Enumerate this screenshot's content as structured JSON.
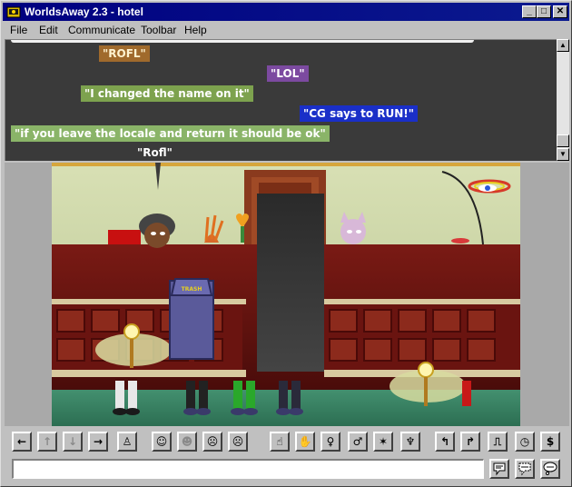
{
  "window": {
    "title": "WorldsAway 2.3 - hotel",
    "controls": {
      "minimize": "_",
      "maximize": "□",
      "close": "✕"
    }
  },
  "menu": {
    "items": [
      "File",
      "Edit",
      "Communicate",
      "Toolbar",
      "Help"
    ]
  },
  "chat": {
    "messages": [
      {
        "text": "\"ROFL\"",
        "color": "#a06a2c",
        "text_color": "#fff3d0"
      },
      {
        "text": "\"LOL\"",
        "color": "#7c4aa0",
        "text_color": "#ffffff"
      },
      {
        "text": "\"I changed the name on it\"",
        "color": "#7da24e",
        "text_color": "#ffffff"
      },
      {
        "text": "\"CG says to RUN!\"",
        "color": "#1a2fc8",
        "text_color": "#ffffff"
      },
      {
        "text": "\"if you leave the locale and return it should be ok\"",
        "color": "#8ab468",
        "text_color": "#ffffff"
      }
    ],
    "speech": "\"Rofl\""
  },
  "scene": {
    "trash_label": "TRASH",
    "colors": {
      "wall": "#cfd8a8",
      "desk": "#6e1414",
      "floor": "#3f8a6a",
      "door": "#8a3a1e"
    }
  },
  "toolbar": {
    "buttons": [
      {
        "name": "arrow-left-icon",
        "glyph": "←",
        "enabled": true
      },
      {
        "name": "arrow-up-icon",
        "glyph": "↑",
        "enabled": false
      },
      {
        "name": "arrow-down-icon",
        "glyph": "↓",
        "enabled": false
      },
      {
        "name": "arrow-right-icon",
        "glyph": "→",
        "enabled": true
      },
      {
        "name": "figure-icon",
        "glyph": "♙",
        "enabled": true
      },
      {
        "name": "face-neutral-icon",
        "glyph": "☺",
        "enabled": true
      },
      {
        "name": "face-smile-icon",
        "glyph": "☻",
        "enabled": false
      },
      {
        "name": "face-sad-icon",
        "glyph": "☹",
        "enabled": true
      },
      {
        "name": "face-angry-icon",
        "glyph": "☹",
        "enabled": true
      },
      {
        "name": "gesture-point-icon",
        "glyph": "☝",
        "enabled": true
      },
      {
        "name": "gesture-wave-icon",
        "glyph": "✋",
        "enabled": true
      },
      {
        "name": "gesture-arms-up-icon",
        "glyph": "♀",
        "enabled": true
      },
      {
        "name": "gesture-walk-icon",
        "glyph": "♂",
        "enabled": true
      },
      {
        "name": "gesture-jump-icon",
        "glyph": "✶",
        "enabled": true
      },
      {
        "name": "gesture-dance-icon",
        "glyph": "♆",
        "enabled": true
      },
      {
        "name": "turn-left-icon",
        "glyph": "↰",
        "enabled": true
      },
      {
        "name": "turn-right-icon",
        "glyph": "↱",
        "enabled": true
      },
      {
        "name": "exit-icon",
        "glyph": "⎍",
        "enabled": true
      },
      {
        "name": "clock-icon",
        "glyph": "◷",
        "enabled": true
      },
      {
        "name": "money-icon",
        "glyph": "$",
        "enabled": true
      }
    ]
  },
  "input": {
    "value": "",
    "placeholder": ""
  },
  "say_buttons": [
    "say-icon",
    "whisper-icon",
    "think-icon"
  ]
}
